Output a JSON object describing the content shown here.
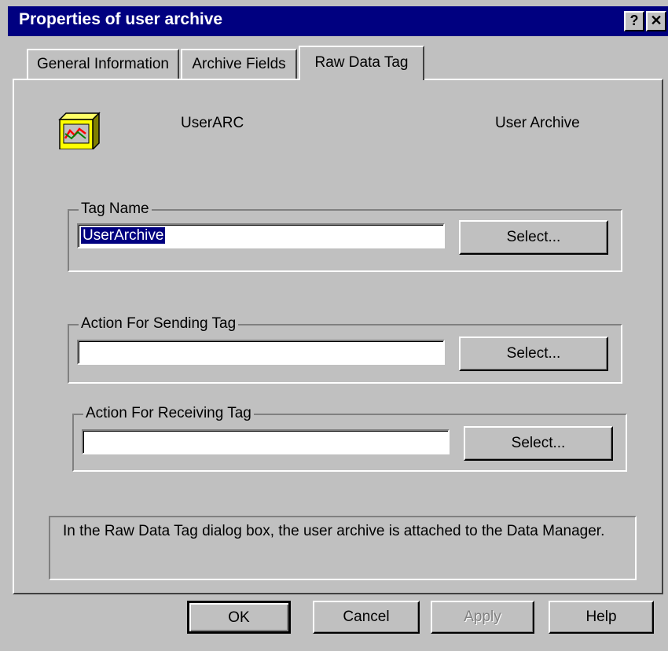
{
  "window": {
    "title": "Properties of user archive",
    "help_glyph": "?",
    "close_glyph": "✕"
  },
  "tabs": [
    {
      "label": "General Information",
      "active": false
    },
    {
      "label": "Archive Fields",
      "active": false
    },
    {
      "label": "Raw Data Tag",
      "active": true
    }
  ],
  "archive": {
    "icon": "user-archive-icon",
    "name": "UserARC",
    "type": "User Archive"
  },
  "tag_name": {
    "legend": "Tag Name",
    "value": "UserArchive",
    "select_label": "Select..."
  },
  "sending_tag": {
    "legend": "Action For Sending Tag",
    "value": "",
    "select_label": "Select..."
  },
  "receiving_tag": {
    "legend": "Action For Receiving Tag",
    "value": "",
    "select_label": "Select..."
  },
  "info": {
    "text": "In the Raw Data Tag dialog box, the user archive is attached to the Data Manager."
  },
  "buttons": {
    "ok": "OK",
    "cancel": "Cancel",
    "apply": "Apply",
    "help": "Help"
  },
  "colors": {
    "title_bar": "#000080",
    "dialog_face": "#c0c0c0",
    "selection": "#000080"
  }
}
